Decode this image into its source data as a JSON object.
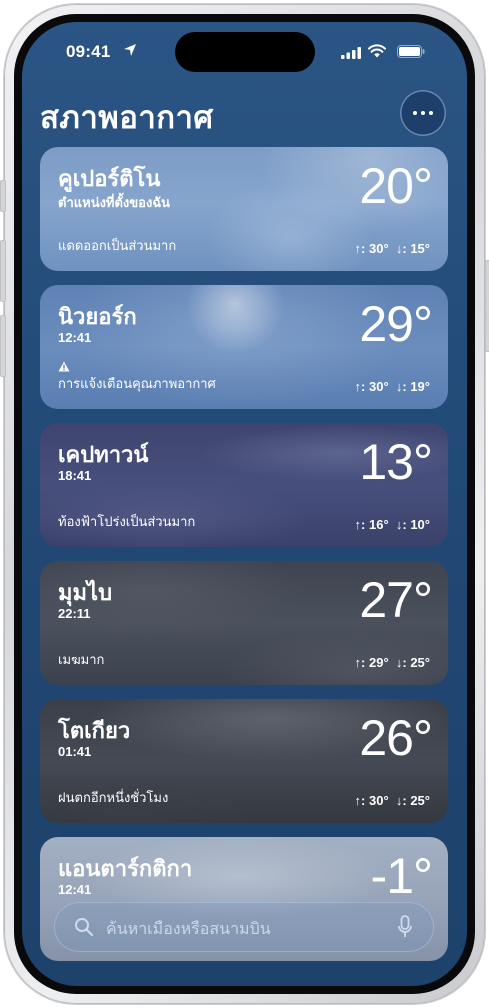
{
  "status_bar": {
    "time": "09:41"
  },
  "header": {
    "title": "สภาพอากาศ"
  },
  "cities": [
    {
      "name": "คูเปอร์ติโน",
      "subtitle": "ตำแหน่งที่ตั้งของฉัน",
      "temp": "20°",
      "condition": "แดดออกเป็นส่วนมาก",
      "high": "↑: 30°",
      "low": "↓: 15°",
      "warning": false
    },
    {
      "name": "นิวยอร์ก",
      "subtitle": "12:41",
      "temp": "29°",
      "condition": "การแจ้งเตือนคุณภาพอากาศ",
      "high": "↑: 30°",
      "low": "↓: 19°",
      "warning": true
    },
    {
      "name": "เคปทาวน์",
      "subtitle": "18:41",
      "temp": "13°",
      "condition": "ท้องฟ้าโปร่งเป็นส่วนมาก",
      "high": "↑: 16°",
      "low": "↓: 10°",
      "warning": false
    },
    {
      "name": "มุมไบ",
      "subtitle": "22:11",
      "temp": "27°",
      "condition": "เมฆมาก",
      "high": "↑: 29°",
      "low": "↓: 25°",
      "warning": false
    },
    {
      "name": "โตเกียว",
      "subtitle": "01:41",
      "temp": "26°",
      "condition": "ฝนตกอีกหนึ่งชั่วโมง",
      "high": "↑: 30°",
      "low": "↓: 25°",
      "warning": false
    },
    {
      "name": "แอนตาร์กติกา",
      "subtitle": "12:41",
      "temp": "-1°",
      "condition": "",
      "high": "",
      "low": "",
      "warning": false
    }
  ],
  "search": {
    "placeholder": "ค้นหาเมืองหรือสนามบิน"
  },
  "icons": {
    "more": "ellipsis-icon",
    "search": "magnifier-icon",
    "mic": "microphone-icon",
    "location": "location-arrow-icon",
    "warning": "warning-triangle-icon"
  }
}
